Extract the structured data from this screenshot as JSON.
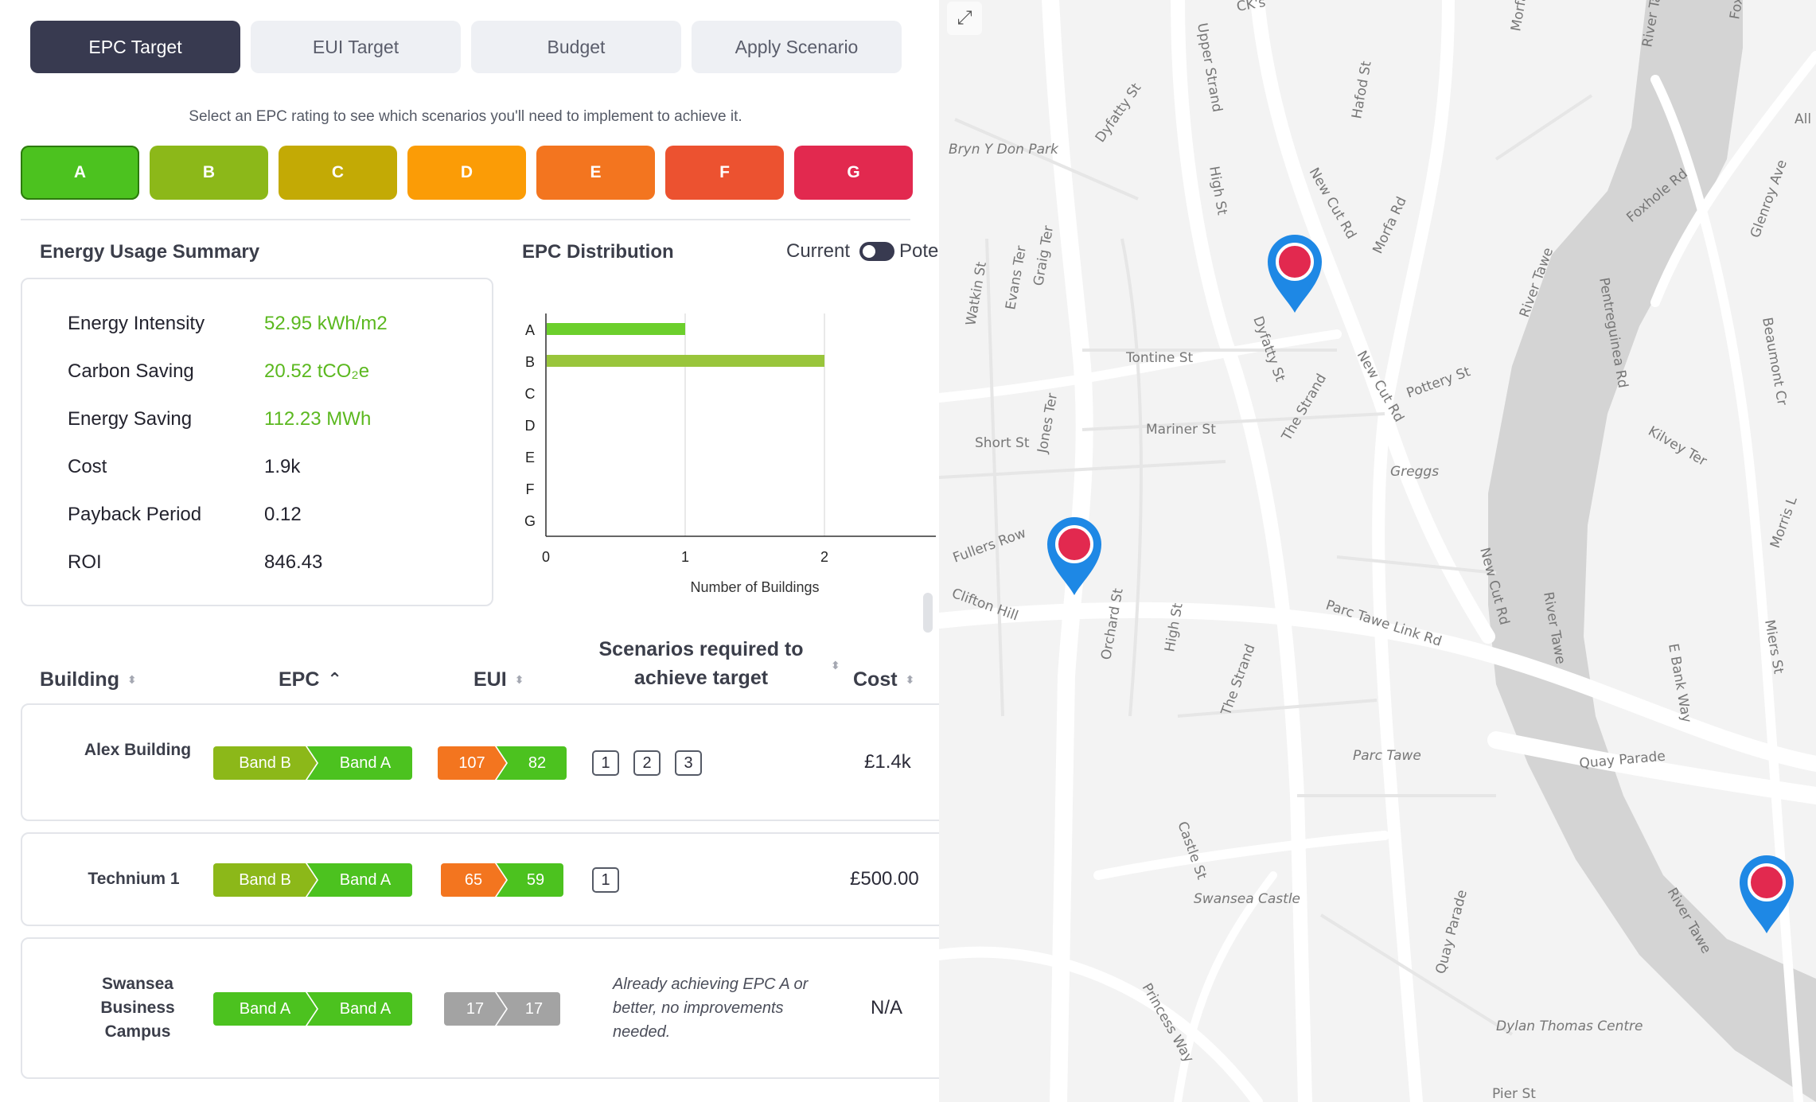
{
  "tabs": [
    {
      "label": "EPC Target",
      "active": true
    },
    {
      "label": "EUI Target",
      "active": false
    },
    {
      "label": "Budget",
      "active": false
    },
    {
      "label": "Apply Scenario",
      "active": false
    }
  ],
  "hint": "Select an EPC rating to see which scenarios you'll need to implement to achieve it.",
  "epc_bands": [
    {
      "label": "A",
      "color": "#4cc21f",
      "selected": true
    },
    {
      "label": "B",
      "color": "#8cb819"
    },
    {
      "label": "C",
      "color": "#c3aa05"
    },
    {
      "label": "D",
      "color": "#fb9c06"
    },
    {
      "label": "E",
      "color": "#f3751f"
    },
    {
      "label": "F",
      "color": "#ec5230"
    },
    {
      "label": "G",
      "color": "#e2294f"
    }
  ],
  "summary": {
    "title": "Energy Usage Summary",
    "rows": [
      {
        "label": "Energy Intensity",
        "value": "52.95 kWh/m2",
        "green": true
      },
      {
        "label": "Carbon Saving",
        "value": "20.52 tCO₂e",
        "green": true
      },
      {
        "label": "Energy Saving",
        "value": "112.23 MWh",
        "green": true
      },
      {
        "label": "Cost",
        "value": "1.9k",
        "green": false
      },
      {
        "label": "Payback Period",
        "value": "0.12",
        "green": false
      },
      {
        "label": "ROI",
        "value": "846.43",
        "green": false
      }
    ]
  },
  "distribution": {
    "title": "EPC Distribution",
    "toggle_left": "Current",
    "toggle_right": "Pote"
  },
  "chart_data": {
    "type": "bar",
    "orientation": "horizontal",
    "title": "EPC Distribution",
    "xlabel": "Number of Buildings",
    "ylabel": "",
    "categories": [
      "A",
      "B",
      "C",
      "D",
      "E",
      "F",
      "G"
    ],
    "values": [
      1,
      2,
      0,
      0,
      0,
      0,
      0
    ],
    "colors": [
      "#6ccf2c",
      "#99c53b",
      "#c3aa05",
      "#fb9c06",
      "#f3751f",
      "#ec5230",
      "#e2294f"
    ],
    "xticks": [
      0,
      1,
      2
    ],
    "xlim": [
      0,
      2.8
    ],
    "grid": true
  },
  "table": {
    "headers": {
      "building": "Building",
      "epc": "EPC",
      "eui": "EUI",
      "scenarios": "Scenarios required to achieve target",
      "cost": "Cost"
    },
    "rows": [
      {
        "building": "Alex Building",
        "epc_from": "Band B",
        "epc_from_color": "#8cb819",
        "epc_to": "Band A",
        "epc_to_color": "#4cc21f",
        "eui_from": "107",
        "eui_from_color": "#f3751f",
        "eui_to": "82",
        "eui_to_color": "#4cc21f",
        "scenarios": [
          "1",
          "2",
          "3"
        ],
        "note": "",
        "cost": "£1.4k"
      },
      {
        "building": "Technium 1",
        "epc_from": "Band B",
        "epc_from_color": "#8cb819",
        "epc_to": "Band A",
        "epc_to_color": "#4cc21f",
        "eui_from": "65",
        "eui_from_color": "#f3751f",
        "eui_to": "59",
        "eui_to_color": "#4cc21f",
        "scenarios": [
          "1"
        ],
        "note": "",
        "cost": "£500.00"
      },
      {
        "building": "Swansea Business Campus",
        "epc_from": "Band A",
        "epc_from_color": "#4cc21f",
        "epc_to": "Band A",
        "epc_to_color": "#4cc21f",
        "eui_from": "17",
        "eui_from_color": "#a3a3a3",
        "eui_to": "17",
        "eui_to_color": "#a3a3a3",
        "scenarios": [],
        "note": "Already achieving EPC A or better, no improvements needed.",
        "cost": "N/A"
      }
    ]
  },
  "map": {
    "expand_icon": "expand-icon",
    "marker_color": "#e2294f",
    "marker_outline": "#1e88e5",
    "labels": [
      "CK's",
      "Upper Strand",
      "Morfa",
      "River Tawe",
      "Foxhole Rd",
      "All S",
      "Bryn Y Don Park",
      "Dyfatty St",
      "High St",
      "New Cut Rd",
      "Hafod St",
      "Morfa Rd",
      "Foxhole Rd",
      "Glenroy Ave",
      "Watkin St",
      "Evans Ter",
      "Graig Ter",
      "River Tawe",
      "Pentreguinea Rd",
      "Beaumont Cr",
      "Tontine St",
      "New Cut Rd",
      "Pottery St",
      "Jones Ter",
      "Dyfatty St",
      "The Strand",
      "Short St",
      "Mariner St",
      "Greggs",
      "Kilvey Ter",
      "Morris L",
      "Fullers Row",
      "Clifton Hill",
      "New Cut Rd",
      "Parc Tawe Link Rd",
      "River Tawe",
      "E Bank Way",
      "Miers St",
      "Orchard St",
      "High St",
      "The Strand",
      "Parc Tawe",
      "Quay Parade",
      "Castle St",
      "Swansea Castle",
      "River Tawe",
      "Quay Parade",
      "Princess Way",
      "Dylan Thomas Centre",
      "Pier St"
    ]
  }
}
